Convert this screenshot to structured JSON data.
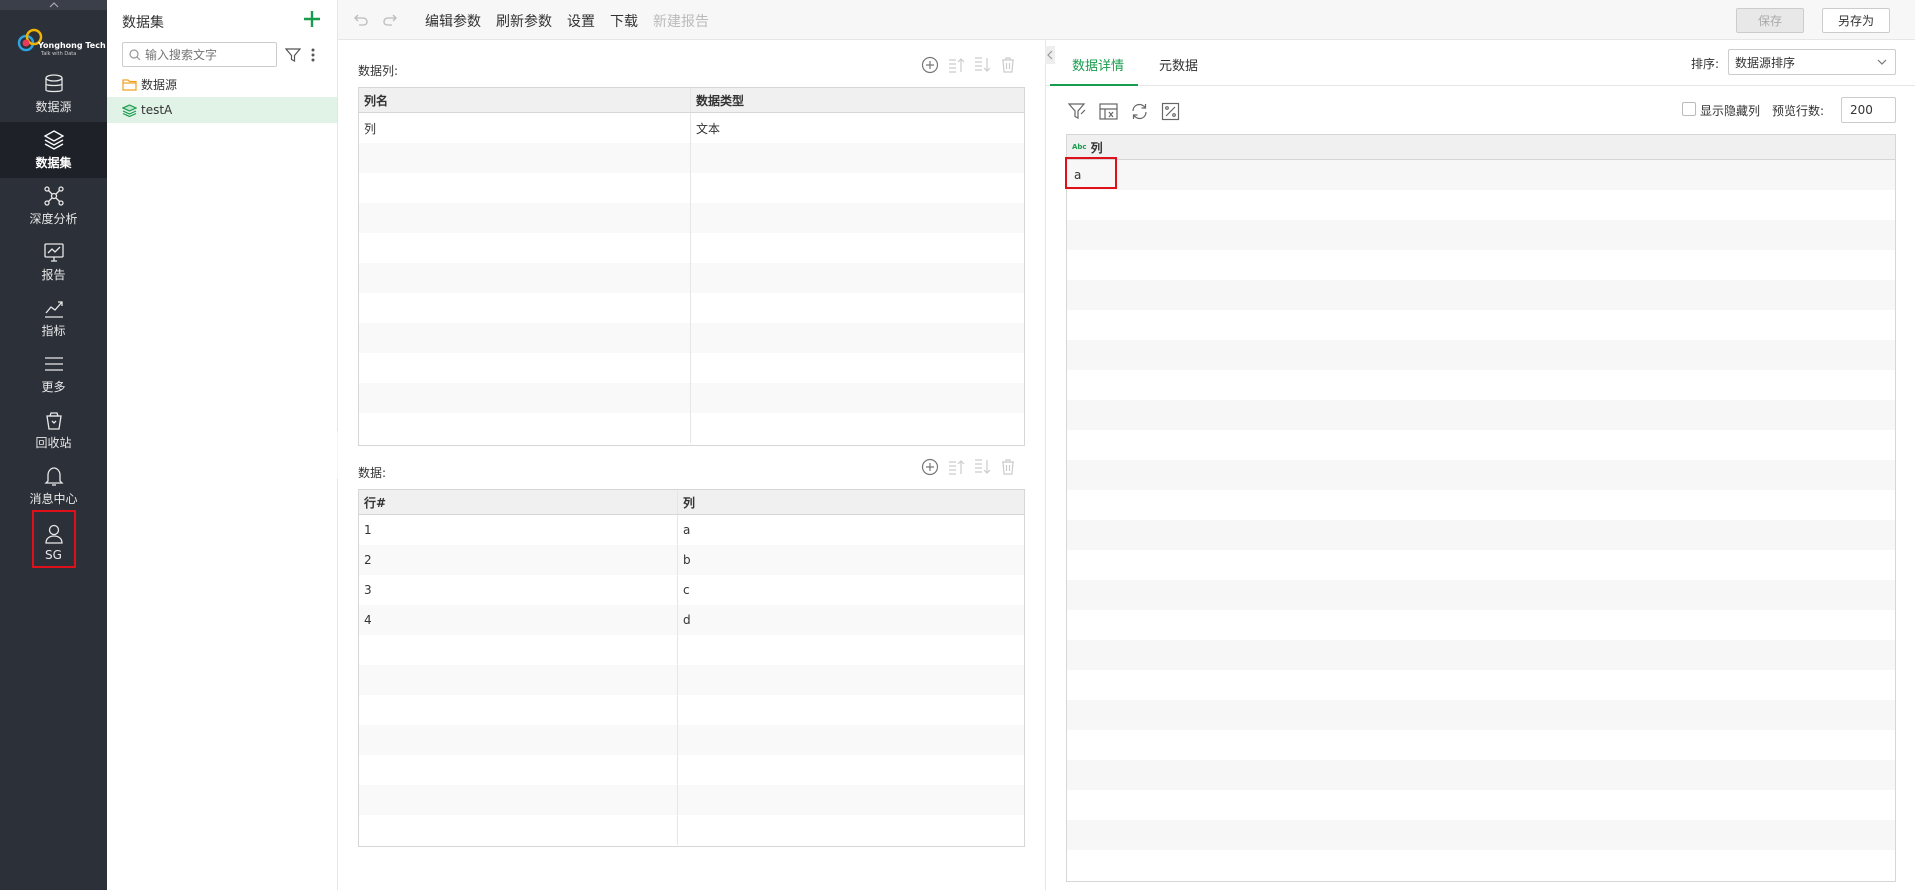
{
  "nav": {
    "logo": {
      "brand": "Yonghong Tech",
      "tagline": "Talk with Data"
    },
    "items": [
      {
        "label": "数据源",
        "icon": "database-icon"
      },
      {
        "label": "数据集",
        "icon": "layers-icon",
        "active": true
      },
      {
        "label": "深度分析",
        "icon": "network-icon"
      },
      {
        "label": "报告",
        "icon": "report-icon"
      },
      {
        "label": "指标",
        "icon": "trend-icon"
      },
      {
        "label": "更多",
        "icon": "menu-icon"
      },
      {
        "label": "回收站",
        "icon": "trash-icon"
      },
      {
        "label": "消息中心",
        "icon": "bell-icon"
      },
      {
        "label": "SG",
        "icon": "user-icon"
      }
    ]
  },
  "tree": {
    "title": "数据集",
    "search_placeholder": "输入搜索文字",
    "nodes": [
      {
        "label": "数据源",
        "icon": "folder-icon"
      },
      {
        "label": "testA",
        "icon": "dataset-icon",
        "selected": true
      }
    ]
  },
  "toolbar": {
    "edit_params": "编辑参数",
    "refresh_params": "刷新参数",
    "settings": "设置",
    "download": "下载",
    "new_report": "新建报告",
    "save": "保存",
    "save_as": "另存为"
  },
  "columns_section": {
    "title": "数据列:",
    "headers": [
      "列名",
      "数据类型"
    ],
    "rows": [
      [
        "列",
        "文本"
      ]
    ]
  },
  "data_section": {
    "title": "数据:",
    "headers": [
      "行#",
      "列"
    ],
    "rows": [
      [
        "1",
        "a"
      ],
      [
        "2",
        "b"
      ],
      [
        "3",
        "c"
      ],
      [
        "4",
        "d"
      ]
    ]
  },
  "right_panel": {
    "tabs": [
      "数据详情",
      "元数据"
    ],
    "sort_label": "排序:",
    "sort_value": "数据源排序",
    "show_hidden_label": "显示隐藏列",
    "preview_rows_label": "预览行数:",
    "preview_rows_value": "200",
    "detail_header_type": "Abc",
    "detail_header": "列",
    "detail_rows": [
      "a"
    ]
  },
  "colors": {
    "accent": "#1a9c4e",
    "nav_bg": "#2c3039",
    "highlight": "#e0101a"
  }
}
